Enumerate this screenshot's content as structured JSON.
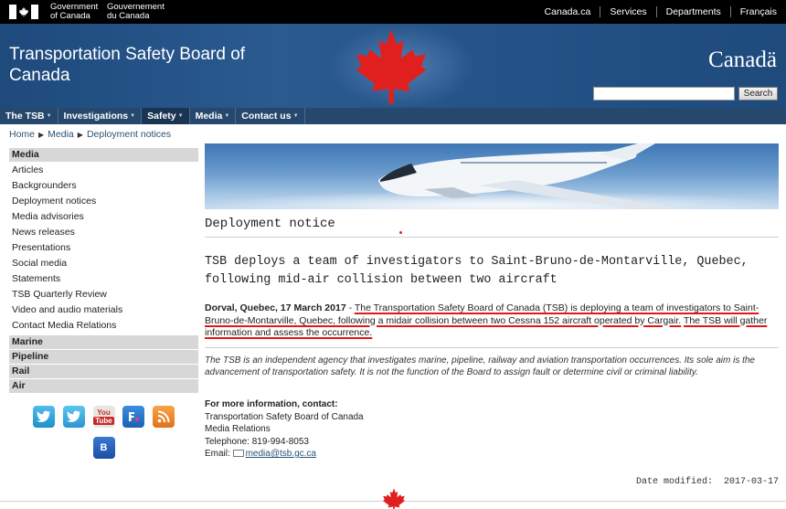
{
  "fip": {
    "gov_en_line1": "Government",
    "gov_en_line2": "of Canada",
    "gov_fr_line1": "Gouvernement",
    "gov_fr_line2": "du Canada",
    "links": [
      "Canada.ca",
      "Services",
      "Departments",
      "Français"
    ]
  },
  "banner": {
    "title_line1": "Transportation Safety Board of",
    "title_line2": "Canada",
    "wordmark": "Canadä",
    "search_button": "Search",
    "search_value": ""
  },
  "menu": {
    "items": [
      "The TSB",
      "Investigations",
      "Safety",
      "Media",
      "Contact us"
    ]
  },
  "breadcrumb": [
    "Home",
    "Media",
    "Deployment notices"
  ],
  "leftnav": {
    "media_title": "Media",
    "media_items": [
      "Articles",
      "Backgrounders",
      "Deployment notices",
      "Media advisories",
      "News releases",
      "Presentations",
      "Social media",
      "Statements",
      "TSB Quarterly Review",
      "Video and audio materials",
      "Contact Media Relations"
    ],
    "sections": [
      "Marine",
      "Pipeline",
      "Rail",
      "Air"
    ]
  },
  "social": {
    "youtube_top": "You",
    "youtube_bottom": "Tube",
    "blog": "B"
  },
  "content": {
    "notice_title": "Deployment notice",
    "headline": "TSB deploys a team of investigators to Saint-Bruno-de-Montarville, Quebec, following mid-air collision between two aircraft",
    "dateline": "Dorval, Quebec, 17 March 2017",
    "dash": " - ",
    "lead_1": "The Transportation Safety Board of Canada (TSB) is deploying a team of investigators to Saint-Bruno-de-Montarville, Quebec, following a midair collision between two Cessna 152 aircraft operated by Cargair.",
    "lead_2": "The TSB will gather information and assess the occurrence.",
    "about": "The TSB is an independent agency that investigates marine, pipeline, railway and aviation transportation occurrences. Its sole aim is the advancement of transportation safety. It is not the function of the Board to assign fault or determine civil or criminal liability.",
    "contact_heading": "For more information, contact:",
    "contact_org": "Transportation Safety Board of Canada",
    "contact_dept": "Media Relations",
    "contact_phone": "Telephone: 819-994-8053",
    "contact_email_label": "Email:",
    "contact_email": "media@tsb.gc.ca",
    "date_modified_label": "Date modified:",
    "date_modified": "2017-03-17"
  },
  "colors": {
    "banner": "#1e4a7c",
    "menu": "#25486c",
    "maple_red": "#e0201f",
    "underline": "#e01818"
  }
}
